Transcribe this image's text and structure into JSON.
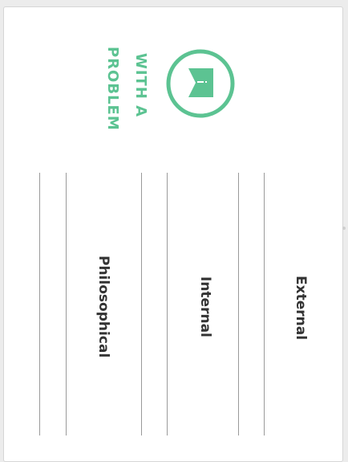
{
  "colors": {
    "accent": "#5cc392",
    "text": "#333333",
    "rule": "#9a9a9a"
  },
  "header": {
    "icon": "flag-speech-icon",
    "line1": "WITH A",
    "line2": "PROBLEM"
  },
  "columns": [
    {
      "label": "External"
    },
    {
      "label": "Internal"
    },
    {
      "label": "Philosophical"
    }
  ]
}
